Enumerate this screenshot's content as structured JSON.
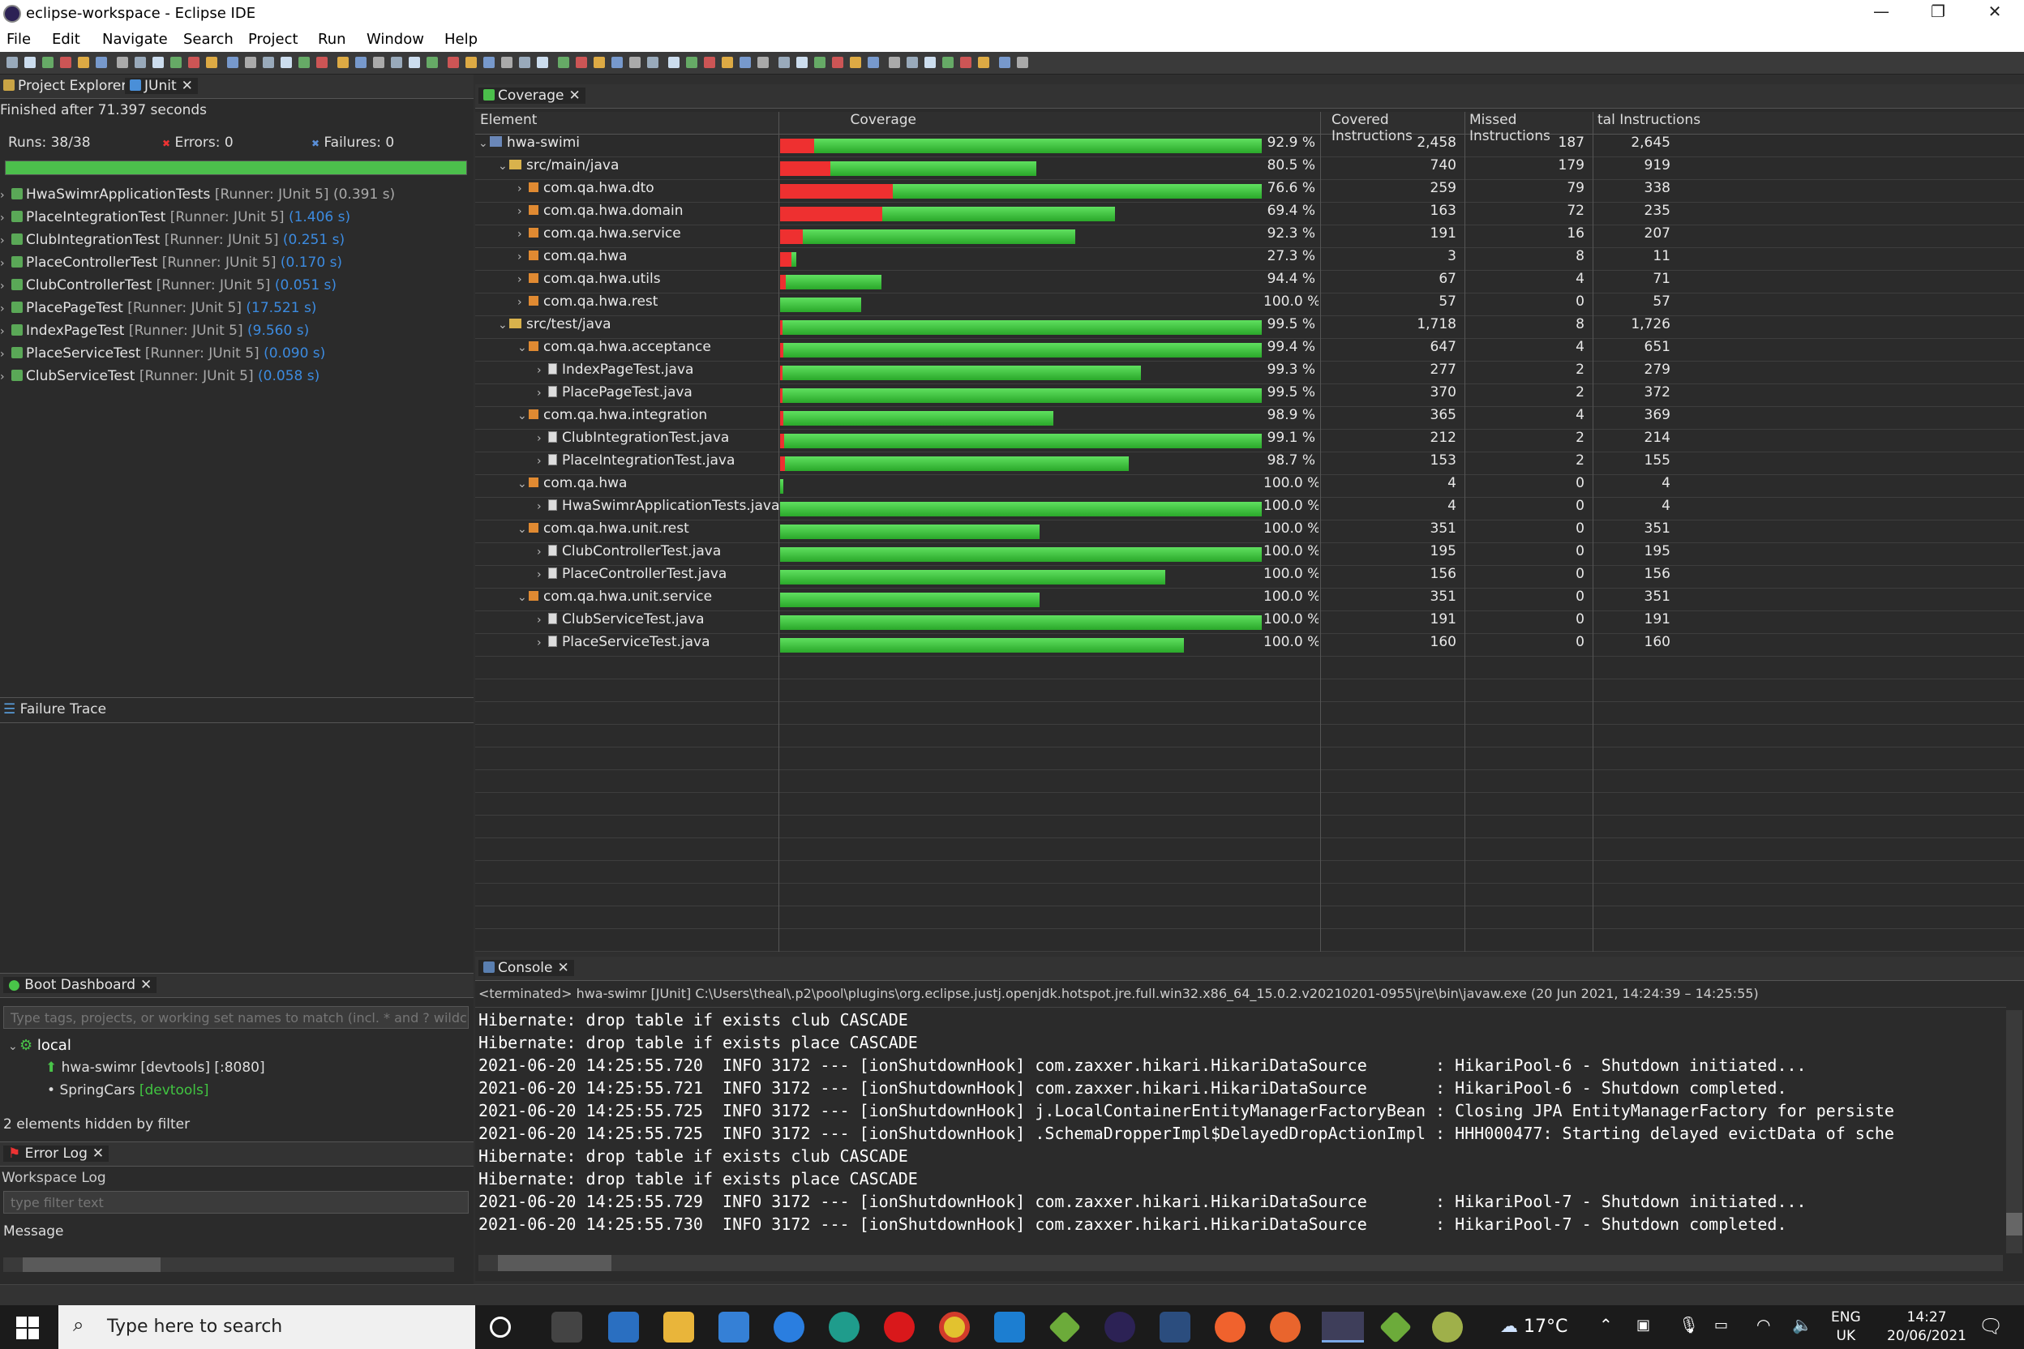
{
  "window": {
    "title": "eclipse-workspace - Eclipse IDE",
    "min": "—",
    "restore": "❐",
    "close": "✕"
  },
  "menu": [
    "File",
    "Edit",
    "Navigate",
    "Search",
    "Project",
    "Run",
    "Window",
    "Help"
  ],
  "left": {
    "tabs": {
      "explorer": "Project Explorer",
      "junit": "JUnit"
    },
    "finished": "Finished after 71.397 seconds",
    "runs_label": "Runs:",
    "runs": "38/38",
    "errors_label": "Errors:",
    "errors": "0",
    "failures_label": "Failures:",
    "failures": "0",
    "progress": 1.0,
    "tests": [
      {
        "name": "HwaSwimrApplicationTests",
        "runner": "[Runner: JUnit 5]",
        "time": "(0.391 s)",
        "time_dim": true
      },
      {
        "name": "PlaceIntegrationTest",
        "runner": "[Runner: JUnit 5]",
        "time": "(1.406 s)"
      },
      {
        "name": "ClubIntegrationTest",
        "runner": "[Runner: JUnit 5]",
        "time": "(0.251 s)"
      },
      {
        "name": "PlaceControllerTest",
        "runner": "[Runner: JUnit 5]",
        "time": "(0.170 s)"
      },
      {
        "name": "ClubControllerTest",
        "runner": "[Runner: JUnit 5]",
        "time": "(0.051 s)"
      },
      {
        "name": "PlacePageTest",
        "runner": "[Runner: JUnit 5]",
        "time": "(17.521 s)"
      },
      {
        "name": "IndexPageTest",
        "runner": "[Runner: JUnit 5]",
        "time": "(9.560 s)"
      },
      {
        "name": "PlaceServiceTest",
        "runner": "[Runner: JUnit 5]",
        "time": "(0.090 s)"
      },
      {
        "name": "ClubServiceTest",
        "runner": "[Runner: JUnit 5]",
        "time": "(0.058 s)"
      }
    ],
    "failure_trace": "Failure Trace",
    "boot": {
      "tab": "Boot Dashboard",
      "filter_placeholder": "Type tags, projects, or working set names to match (incl. * and ? wildcar",
      "local": "local",
      "app": "hwa-swimr [devtools] [:8080]",
      "app2": "SpringCars",
      "app2_tag": "[devtools]",
      "hidden": "2 elements hidden by filter"
    },
    "errorlog": {
      "tab": "Error Log",
      "workspace": "Workspace Log",
      "filter_placeholder": "type filter text",
      "message": "Message"
    }
  },
  "coverage": {
    "tab": "Coverage",
    "headers": {
      "element": "Element",
      "coverage": "Coverage",
      "covered": "Covered Instructions",
      "missed": "Missed Instructions",
      "total": "tal Instructions"
    },
    "rows": [
      {
        "level": 0,
        "kind": "proj",
        "exp": "v",
        "name": "hwa-swimi",
        "cov": 0.929,
        "covtxt": "92.9 %",
        "covered": "2,458",
        "missed": "187",
        "total": "2,645",
        "w": 1.0
      },
      {
        "level": 1,
        "kind": "folder",
        "exp": "v",
        "name": "src/main/java",
        "cov": 0.805,
        "covtxt": "80.5 %",
        "covered": "740",
        "missed": "179",
        "total": "919",
        "w": 0.532
      },
      {
        "level": 2,
        "kind": "pkg",
        "exp": ">",
        "name": "com.qa.hwa.dto",
        "cov": 0.766,
        "covtxt": "76.6 %",
        "covered": "259",
        "missed": "79",
        "total": "338",
        "w": 1.0
      },
      {
        "level": 2,
        "kind": "pkg",
        "exp": ">",
        "name": "com.qa.hwa.domain",
        "cov": 0.694,
        "covtxt": "69.4 %",
        "covered": "163",
        "missed": "72",
        "total": "235",
        "w": 0.695
      },
      {
        "level": 2,
        "kind": "pkg",
        "exp": ">",
        "name": "com.qa.hwa.service",
        "cov": 0.923,
        "covtxt": "92.3 %",
        "covered": "191",
        "missed": "16",
        "total": "207",
        "w": 0.612
      },
      {
        "level": 2,
        "kind": "pkg",
        "exp": ">",
        "name": "com.qa.hwa",
        "cov": 0.273,
        "covtxt": "27.3 %",
        "covered": "3",
        "missed": "8",
        "total": "11",
        "w": 0.033
      },
      {
        "level": 2,
        "kind": "pkg",
        "exp": ">",
        "name": "com.qa.hwa.utils",
        "cov": 0.944,
        "covtxt": "94.4 %",
        "covered": "67",
        "missed": "4",
        "total": "71",
        "w": 0.21
      },
      {
        "level": 2,
        "kind": "pkg",
        "exp": ">",
        "name": "com.qa.hwa.rest",
        "cov": 1.0,
        "covtxt": "100.0 %",
        "covered": "57",
        "missed": "0",
        "total": "57",
        "w": 0.169
      },
      {
        "level": 1,
        "kind": "folder",
        "exp": "v",
        "name": "src/test/java",
        "cov": 0.995,
        "covtxt": "99.5 %",
        "covered": "1,718",
        "missed": "8",
        "total": "1,726",
        "w": 1.0
      },
      {
        "level": 2,
        "kind": "pkg",
        "exp": "v",
        "name": "com.qa.hwa.acceptance",
        "cov": 0.994,
        "covtxt": "99.4 %",
        "covered": "647",
        "missed": "4",
        "total": "651",
        "w": 1.0
      },
      {
        "level": 3,
        "kind": "file",
        "exp": ">",
        "name": "IndexPageTest.java",
        "cov": 0.993,
        "covtxt": "99.3 %",
        "covered": "277",
        "missed": "2",
        "total": "279",
        "w": 0.75
      },
      {
        "level": 3,
        "kind": "file",
        "exp": ">",
        "name": "PlacePageTest.java",
        "cov": 0.995,
        "covtxt": "99.5 %",
        "covered": "370",
        "missed": "2",
        "total": "372",
        "w": 1.0
      },
      {
        "level": 2,
        "kind": "pkg",
        "exp": "v",
        "name": "com.qa.hwa.integration",
        "cov": 0.989,
        "covtxt": "98.9 %",
        "covered": "365",
        "missed": "4",
        "total": "369",
        "w": 0.567
      },
      {
        "level": 3,
        "kind": "file",
        "exp": ">",
        "name": "ClubIntegrationTest.java",
        "cov": 0.991,
        "covtxt": "99.1 %",
        "covered": "212",
        "missed": "2",
        "total": "214",
        "w": 1.0
      },
      {
        "level": 3,
        "kind": "file",
        "exp": ">",
        "name": "PlaceIntegrationTest.java",
        "cov": 0.987,
        "covtxt": "98.7 %",
        "covered": "153",
        "missed": "2",
        "total": "155",
        "w": 0.724
      },
      {
        "level": 2,
        "kind": "pkg",
        "exp": "v",
        "name": "com.qa.hwa",
        "cov": 1.0,
        "covtxt": "100.0 %",
        "covered": "4",
        "missed": "0",
        "total": "4",
        "w": 0.006
      },
      {
        "level": 3,
        "kind": "file",
        "exp": ">",
        "name": "HwaSwimrApplicationTests.java",
        "cov": 1.0,
        "covtxt": "100.0 %",
        "covered": "4",
        "missed": "0",
        "total": "4",
        "w": 1.0
      },
      {
        "level": 2,
        "kind": "pkg",
        "exp": "v",
        "name": "com.qa.hwa.unit.rest",
        "cov": 1.0,
        "covtxt": "100.0 %",
        "covered": "351",
        "missed": "0",
        "total": "351",
        "w": 0.539
      },
      {
        "level": 3,
        "kind": "file",
        "exp": ">",
        "name": "ClubControllerTest.java",
        "cov": 1.0,
        "covtxt": "100.0 %",
        "covered": "195",
        "missed": "0",
        "total": "195",
        "w": 1.0
      },
      {
        "level": 3,
        "kind": "file",
        "exp": ">",
        "name": "PlaceControllerTest.java",
        "cov": 1.0,
        "covtxt": "100.0 %",
        "covered": "156",
        "missed": "0",
        "total": "156",
        "w": 0.8
      },
      {
        "level": 2,
        "kind": "pkg",
        "exp": "v",
        "name": "com.qa.hwa.unit.service",
        "cov": 1.0,
        "covtxt": "100.0 %",
        "covered": "351",
        "missed": "0",
        "total": "351",
        "w": 0.539
      },
      {
        "level": 3,
        "kind": "file",
        "exp": ">",
        "name": "ClubServiceTest.java",
        "cov": 1.0,
        "covtxt": "100.0 %",
        "covered": "191",
        "missed": "0",
        "total": "191",
        "w": 1.0
      },
      {
        "level": 3,
        "kind": "file",
        "exp": ">",
        "name": "PlaceServiceTest.java",
        "cov": 1.0,
        "covtxt": "100.0 %",
        "covered": "160",
        "missed": "0",
        "total": "160",
        "w": 0.838
      }
    ]
  },
  "console": {
    "tab": "Console",
    "terminated": "<terminated> hwa-swimr [JUnit] C:\\Users\\theal\\.p2\\pool\\plugins\\org.eclipse.justj.openjdk.hotspot.jre.full.win32.x86_64_15.0.2.v20210201-0955\\jre\\bin\\javaw.exe  (20 Jun 2021, 14:24:39 – 14:25:55)",
    "lines": [
      "Hibernate: drop table if exists club CASCADE",
      "Hibernate: drop table if exists place CASCADE",
      "2021-06-20 14:25:55.720  INFO 3172 --- [ionShutdownHook] com.zaxxer.hikari.HikariDataSource       : HikariPool-6 - Shutdown initiated...",
      "2021-06-20 14:25:55.721  INFO 3172 --- [ionShutdownHook] com.zaxxer.hikari.HikariDataSource       : HikariPool-6 - Shutdown completed.",
      "2021-06-20 14:25:55.725  INFO 3172 --- [ionShutdownHook] j.LocalContainerEntityManagerFactoryBean : Closing JPA EntityManagerFactory for persiste",
      "2021-06-20 14:25:55.725  INFO 3172 --- [ionShutdownHook] .SchemaDropperImpl$DelayedDropActionImpl : HHH000477: Starting delayed evictData of sche",
      "Hibernate: drop table if exists club CASCADE",
      "Hibernate: drop table if exists place CASCADE",
      "2021-06-20 14:25:55.729  INFO 3172 --- [ionShutdownHook] com.zaxxer.hikari.HikariDataSource       : HikariPool-7 - Shutdown initiated...",
      "2021-06-20 14:25:55.730  INFO 3172 --- [ionShutdownHook] com.zaxxer.hikari.HikariDataSource       : HikariPool-7 - Shutdown completed."
    ]
  },
  "taskbar": {
    "search": "Type here to search",
    "weather": "17°C",
    "lang": "ENG",
    "region": "UK",
    "time": "14:27",
    "date": "20/06/2021"
  },
  "colors": {
    "bar_red": "#ee3030",
    "bar_green": "#3ec43e",
    "link": "#3c8be0"
  }
}
